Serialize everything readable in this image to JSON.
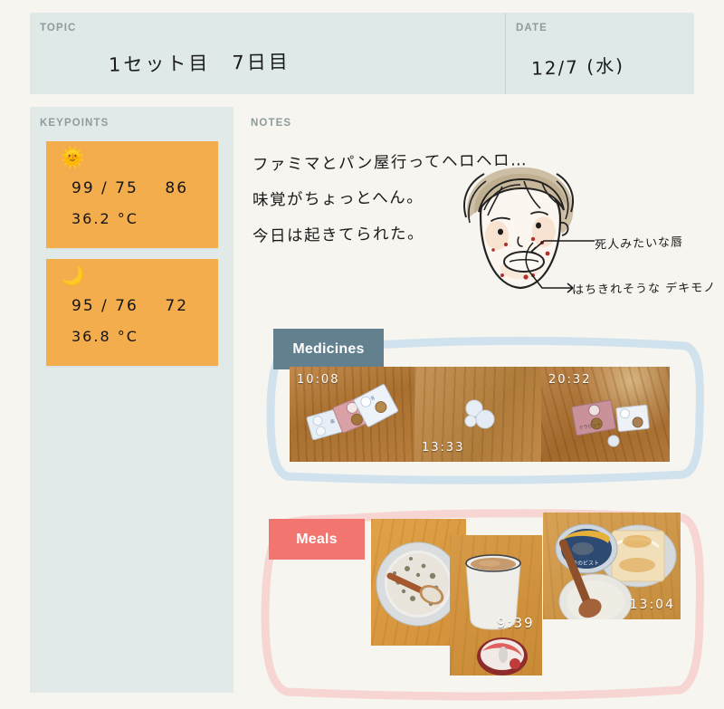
{
  "header": {
    "topic_label": "TOPIC",
    "topic_value": "1セット目　7日目",
    "date_label": "DATE",
    "date_value": "12/7 (水)"
  },
  "sidebar": {
    "label": "KEYPOINTS",
    "cards": [
      {
        "icon": "sun-emoji",
        "glyph": "🌞",
        "blood_pressure": "99 / 75    86",
        "temperature": "36.2 °C",
        "bg": "#f3ad4c"
      },
      {
        "icon": "crescent-moon-emoji",
        "glyph": "🌙",
        "blood_pressure": "95 / 76    72",
        "temperature": "36.8 °C",
        "bg": "#f3ad4c"
      }
    ]
  },
  "notes": {
    "label": "NOTES",
    "lines": [
      "ファミマとパン屋行ってヘロヘロ…",
      "味覚がちょっとへん。",
      "今日は起きてられた。"
    ],
    "doodle_name": "self-portrait-face-doodle",
    "callouts": [
      "死人みたいな唇",
      "はちきれそうな デキモノ"
    ]
  },
  "sections": [
    {
      "label": "Medicines",
      "label_color": "#63808f",
      "frame_color": "#cfe2ee",
      "photos": [
        {
          "name": "medicine-photo-morning",
          "time": "10:08",
          "time_pos": "top-left"
        },
        {
          "name": "medicine-photo-midday",
          "time": "13:33",
          "time_pos": "bottom-left"
        },
        {
          "name": "medicine-photo-evening",
          "time": "20:32",
          "time_pos": "top-left"
        }
      ]
    },
    {
      "label": "Meals",
      "label_color": "#f2756f",
      "frame_color": "#f6d5d3",
      "photos": [
        {
          "name": "meal-photo-rice-bowl",
          "time": "",
          "time_pos": ""
        },
        {
          "name": "meal-photo-coffee-yogurt",
          "time": "9:39",
          "time_pos": "middle-right"
        },
        {
          "name": "meal-photo-toast-set",
          "time": "13:04",
          "time_pos": "bottom-right"
        }
      ]
    }
  ],
  "colors": {
    "page_bg": "#f7f5f0",
    "panel_bg": "#dfe9e8",
    "sidebar_bg": "#e1eae9",
    "card_orange": "#f3ad4c",
    "label_gray": "#8f9b9b"
  }
}
